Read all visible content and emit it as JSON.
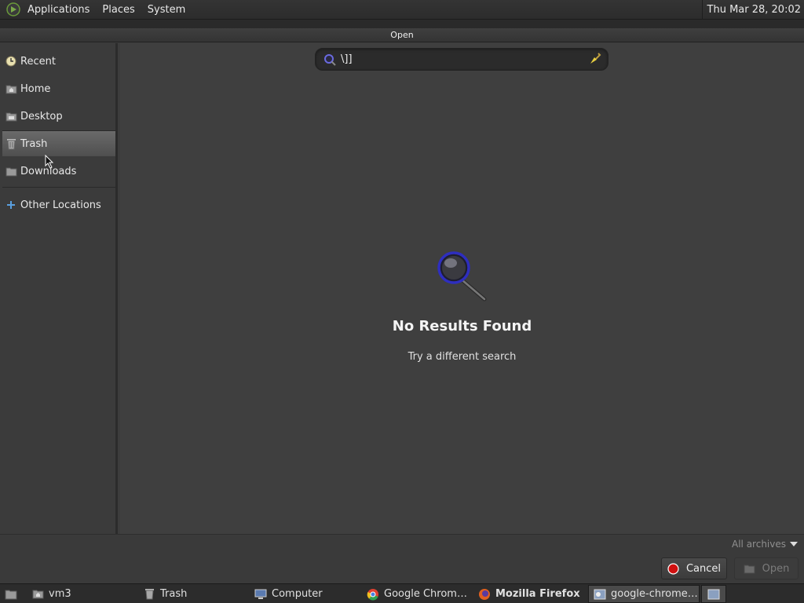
{
  "top_panel": {
    "menus": [
      "Applications",
      "Places",
      "System"
    ],
    "clock": "Thu Mar 28, 20:02"
  },
  "dialog": {
    "title": "Open",
    "sidebar": {
      "items": [
        {
          "label": "Recent",
          "icon": "recent-icon"
        },
        {
          "label": "Home",
          "icon": "home-folder-icon"
        },
        {
          "label": "Desktop",
          "icon": "desktop-folder-icon"
        },
        {
          "label": "Trash",
          "icon": "trash-icon"
        },
        {
          "label": "Downloads",
          "icon": "downloads-folder-icon"
        },
        {
          "label": "Other Locations",
          "icon": "plus-icon"
        }
      ],
      "selected": "Trash"
    },
    "search": {
      "value": "\\]]",
      "icon": "search-icon",
      "clear_icon": "clear-broom-icon"
    },
    "empty_state": {
      "icon": "magnifier-icon",
      "title": "No Results Found",
      "subtitle": "Try a different search"
    },
    "filter": {
      "selected": "All archives"
    },
    "buttons": {
      "cancel": "Cancel",
      "open": "Open"
    }
  },
  "taskbar": {
    "items": [
      {
        "label": "",
        "icon": "show-desktop-icon"
      },
      {
        "label": "vm3",
        "icon": "home-folder-icon"
      },
      {
        "label": "Trash",
        "icon": "trash-icon"
      },
      {
        "label": "Computer",
        "icon": "computer-icon"
      },
      {
        "label": "Google Chrom…",
        "icon": "chrome-icon"
      },
      {
        "label": "Mozilla Firefox",
        "icon": "firefox-icon"
      },
      {
        "label": "google-chrome…",
        "icon": "file-dialog-icon"
      },
      {
        "label": "",
        "icon": "workspace-icon"
      }
    ]
  },
  "colors": {
    "accent_cancel": "#d01010",
    "search_ring": "#3b3bd0"
  }
}
